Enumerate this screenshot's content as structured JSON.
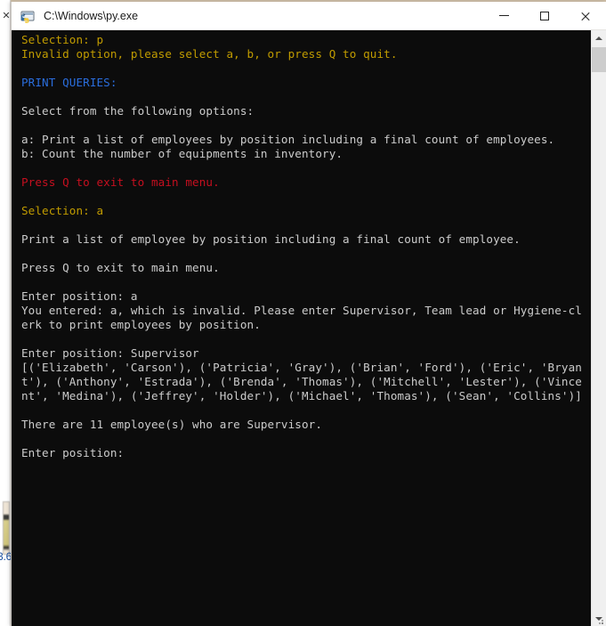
{
  "window": {
    "title": "C:\\Windows\\py.exe",
    "icon": "python-console-icon",
    "controls": {
      "minimize": "–",
      "maximize": "□",
      "close": "✕"
    }
  },
  "background": {
    "close_x": "✕",
    "version_label": "3.6"
  },
  "colors": {
    "console_bg": "#0c0c0c",
    "text_white": "#cccccc",
    "text_orange": "#c19c00",
    "text_blue": "#2a6ede",
    "text_red": "#c50f1f",
    "titlebar_bg": "#ffffff"
  },
  "console": {
    "lines": [
      {
        "text": "Selection: p",
        "color": "orange"
      },
      {
        "text": "Invalid option, please select a, b, or press Q to quit.",
        "color": "orange"
      },
      {
        "text": "",
        "color": "white"
      },
      {
        "text": "PRINT QUERIES:",
        "color": "blue"
      },
      {
        "text": "",
        "color": "white"
      },
      {
        "text": "Select from the following options:",
        "color": "white"
      },
      {
        "text": "",
        "color": "white"
      },
      {
        "text": "a: Print a list of employees by position including a final count of employees.",
        "color": "white"
      },
      {
        "text": "b: Count the number of equipments in inventory.",
        "color": "white"
      },
      {
        "text": "",
        "color": "white"
      },
      {
        "text": "Press Q to exit to main menu.",
        "color": "red"
      },
      {
        "text": "",
        "color": "white"
      },
      {
        "text": "Selection: a",
        "color": "orange"
      },
      {
        "text": "",
        "color": "white"
      },
      {
        "text": "Print a list of employee by position including a final count of employee.",
        "color": "white"
      },
      {
        "text": "",
        "color": "white"
      },
      {
        "text": "Press Q to exit to main menu.",
        "color": "white"
      },
      {
        "text": "",
        "color": "white"
      },
      {
        "text": "Enter position: a",
        "color": "white"
      },
      {
        "text": "You entered: a, which is invalid. Please enter Supervisor, Team lead or Hygiene-cl",
        "color": "white"
      },
      {
        "text": "erk to print employees by position.",
        "color": "white"
      },
      {
        "text": "",
        "color": "white"
      },
      {
        "text": "Enter position: Supervisor",
        "color": "white"
      },
      {
        "text": "[('Elizabeth', 'Carson'), ('Patricia', 'Gray'), ('Brian', 'Ford'), ('Eric', 'Bryan",
        "color": "white"
      },
      {
        "text": "t'), ('Anthony', 'Estrada'), ('Brenda', 'Thomas'), ('Mitchell', 'Lester'), ('Vince",
        "color": "white"
      },
      {
        "text": "nt', 'Medina'), ('Jeffrey', 'Holder'), ('Michael', 'Thomas'), ('Sean', 'Collins')]",
        "color": "white"
      },
      {
        "text": "",
        "color": "white"
      },
      {
        "text": "There are 11 employee(s) who are Supervisor.",
        "color": "white"
      },
      {
        "text": "",
        "color": "white"
      },
      {
        "text": "Enter position:",
        "color": "white"
      }
    ],
    "query_results": {
      "position": "Supervisor",
      "count_message": "There are 11 employee(s) who are Supervisor.",
      "count": 11,
      "employees": [
        [
          "Elizabeth",
          "Carson"
        ],
        [
          "Patricia",
          "Gray"
        ],
        [
          "Brian",
          "Ford"
        ],
        [
          "Eric",
          "Bryant"
        ],
        [
          "Anthony",
          "Estrada"
        ],
        [
          "Brenda",
          "Thomas"
        ],
        [
          "Mitchell",
          "Lester"
        ],
        [
          "Vincent",
          "Medina"
        ],
        [
          "Jeffrey",
          "Holder"
        ],
        [
          "Michael",
          "Thomas"
        ],
        [
          "Sean",
          "Collins"
        ]
      ]
    },
    "menu": {
      "heading": "PRINT QUERIES:",
      "prompt": "Select from the following options:",
      "options": [
        "a: Print a list of employees by position including a final count of employees.",
        "b: Count the number of equipments in inventory."
      ],
      "exit_hint": "Press Q to exit to main menu.",
      "invalid_option_message": "Invalid option, please select a, b, or press Q to quit."
    }
  },
  "scrollbar": {
    "up_arrow": "▲",
    "down_arrow": "▼"
  }
}
